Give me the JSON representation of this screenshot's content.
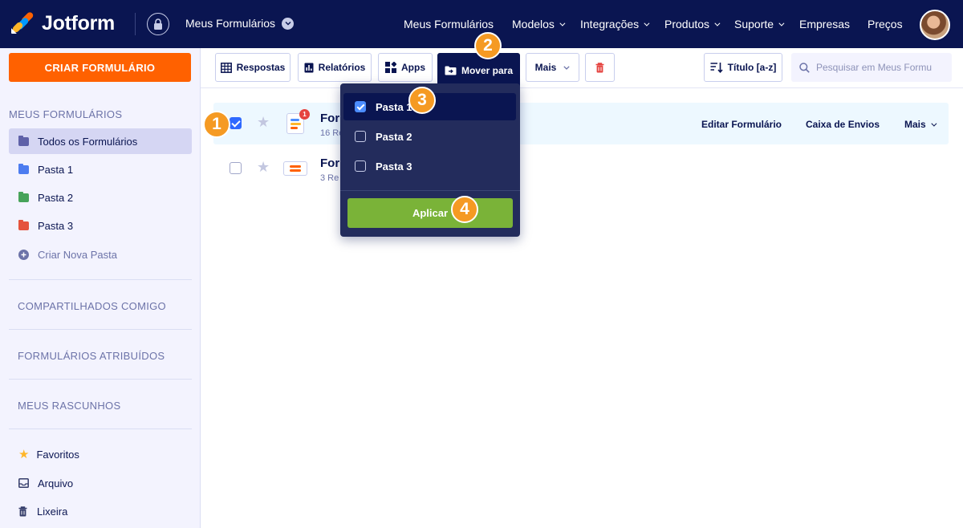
{
  "header": {
    "logo_text": "Jotform",
    "my_forms": "Meus Formulários",
    "nav": [
      {
        "label": "Meus Formulários",
        "has_caret": false
      },
      {
        "label": "Modelos",
        "has_caret": true
      },
      {
        "label": "Integrações",
        "has_caret": true
      },
      {
        "label": "Produtos",
        "has_caret": true
      },
      {
        "label": "Suporte",
        "has_caret": true
      },
      {
        "label": "Empresas",
        "has_caret": false
      },
      {
        "label": "Preços",
        "has_caret": false
      }
    ]
  },
  "sidebar": {
    "create_label": "CRIAR FORMULÁRIO",
    "section_my_forms": "MEUS FORMULÁRIOS",
    "folders": [
      {
        "label": "Todos os Formulários",
        "color": "#5f61a8",
        "active": true
      },
      {
        "label": "Pasta 1",
        "color": "#4c7cf0",
        "active": false
      },
      {
        "label": "Pasta 2",
        "color": "#47a35a",
        "active": false
      },
      {
        "label": "Pasta 3",
        "color": "#e5533d",
        "active": false
      }
    ],
    "new_folder": "Criar Nova Pasta",
    "shared": "COMPARTILHADOS COMIGO",
    "assigned": "FORMULÁRIOS ATRIBUÍDOS",
    "drafts": "MEUS RASCUNHOS",
    "favorites": "Favoritos",
    "archive": "Arquivo",
    "trash": "Lixeira"
  },
  "toolbar": {
    "responses": "Respostas",
    "reports": "Relatórios",
    "apps": "Apps",
    "move_to": "Mover para",
    "more": "Mais",
    "sort": "Título [a-z]",
    "search_placeholder": "Pesquisar em Meus Formu"
  },
  "forms": [
    {
      "title": "For",
      "sub": "16 Re",
      "checked": true,
      "notifications": "1"
    },
    {
      "title": "For",
      "sub": "3 Re",
      "checked": false,
      "notifications": ""
    }
  ],
  "row_actions": {
    "edit": "Editar Formulário",
    "inbox": "Caixa de Envios",
    "more": "Mais"
  },
  "move_dropdown": {
    "options": [
      {
        "label": "Pasta 1",
        "checked": true
      },
      {
        "label": "Pasta 2",
        "checked": false
      },
      {
        "label": "Pasta 3",
        "checked": false
      }
    ],
    "apply": "Aplicar"
  },
  "steps": [
    "1",
    "2",
    "3",
    "4"
  ],
  "colors": {
    "navy": "#0a1551",
    "orange": "#ff6100",
    "green": "#7ab338",
    "step": "#f59a23",
    "checkbox_blue": "#2e69ff"
  }
}
